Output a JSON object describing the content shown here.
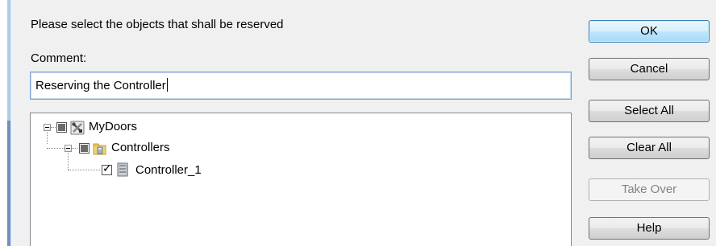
{
  "dialog": {
    "prompt": "Please select the objects that shall be reserved",
    "comment_label": "Comment:",
    "comment_value": "Reserving the Controller"
  },
  "tree": {
    "nodes": [
      {
        "label": "MyDoors",
        "state": "indeterminate",
        "icon": "tools-folder-icon"
      },
      {
        "label": "Controllers",
        "state": "indeterminate",
        "icon": "folder-icon"
      },
      {
        "label": "Controller_1",
        "state": "checked",
        "icon": "controller-device-icon"
      }
    ]
  },
  "buttons": {
    "ok": "OK",
    "cancel": "Cancel",
    "select_all": "Select All",
    "clear_all": "Clear All",
    "take_over": "Take Over",
    "help": "Help"
  },
  "colors": {
    "default_button_border": "#3c7fb1",
    "input_border": "#7aa1d2",
    "disabled_text": "#838383"
  }
}
